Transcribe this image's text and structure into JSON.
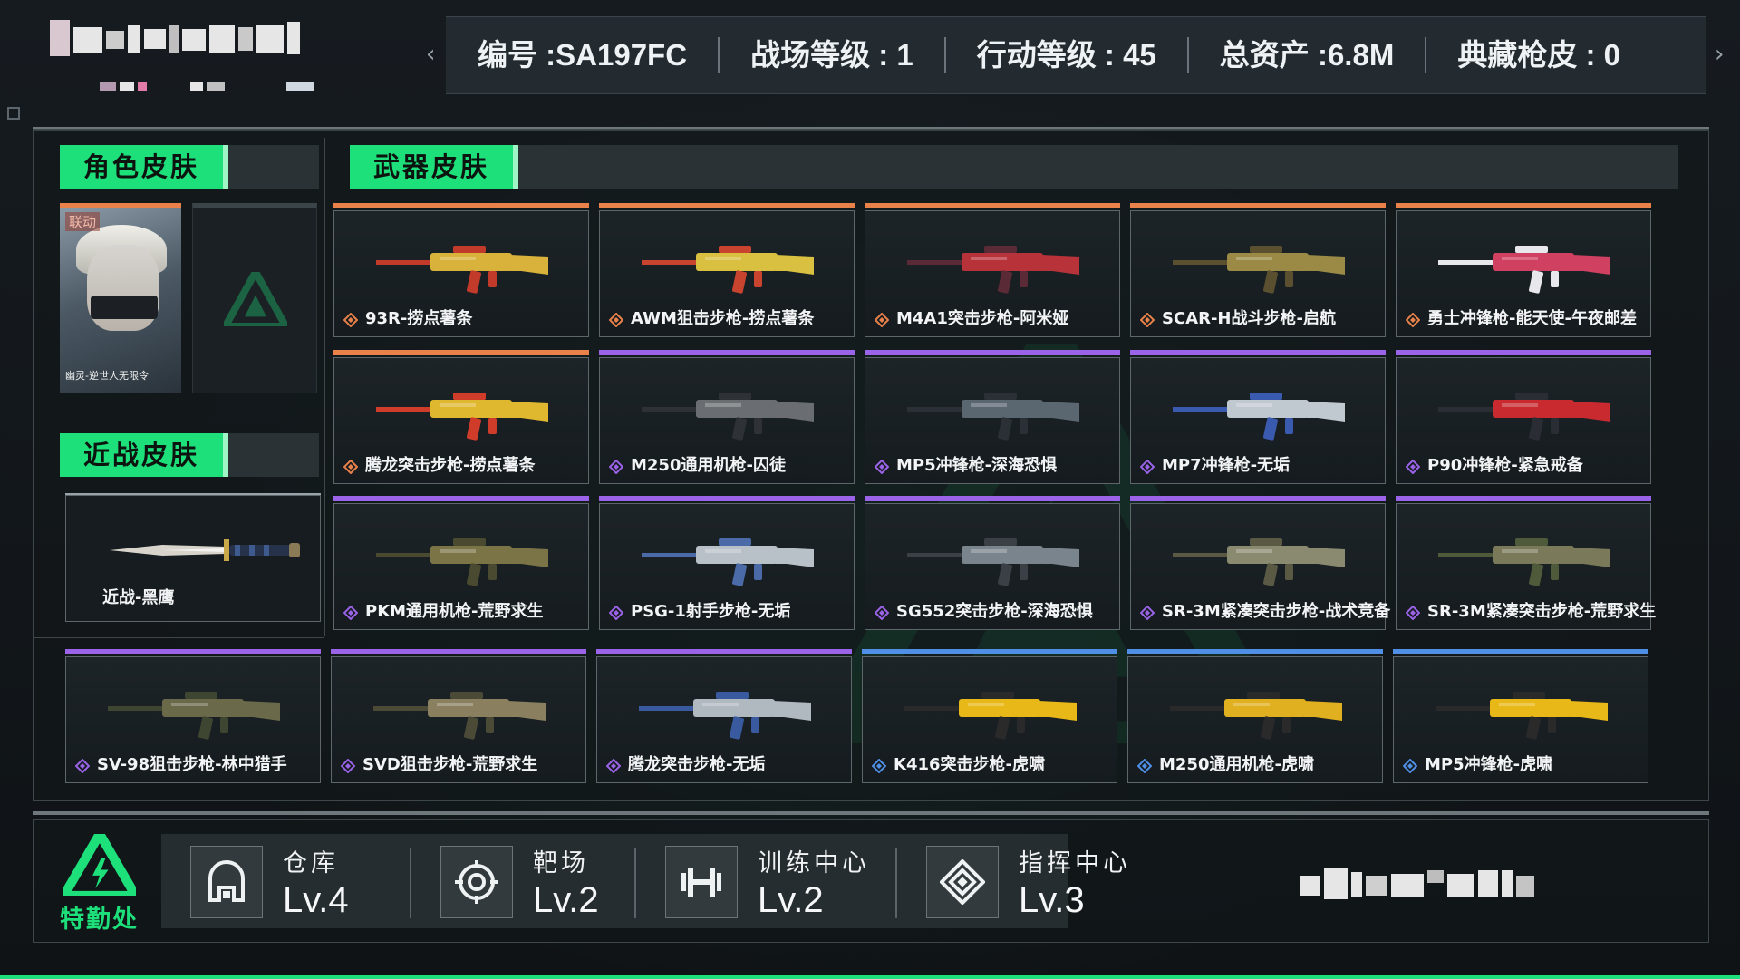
{
  "header": {
    "stats": [
      "编号 :SA197FC",
      "战场等级 : 1",
      "行动等级 :  45",
      "总资产 :6.8M",
      "典藏枪皮 : 0"
    ],
    "nav_left": "‹",
    "nav_right": "›"
  },
  "sections": {
    "character": "角色皮肤",
    "weapon": "武器皮肤",
    "melee": "近战皮肤"
  },
  "character_skin": {
    "badge": "联动",
    "caption": "幽灵-逆世人无限令"
  },
  "melee_skin": {
    "name": "近战-黑鹰"
  },
  "weapons": [
    {
      "name": "93R-捞点薯条",
      "rarity": "orange"
    },
    {
      "name": "AWM狙击步枪-捞点薯条",
      "rarity": "orange"
    },
    {
      "name": "M4A1突击步枪-阿米娅",
      "rarity": "orange"
    },
    {
      "name": "SCAR-H战斗步枪-启航",
      "rarity": "orange"
    },
    {
      "name": "勇士冲锋枪-能天使-午夜邮差",
      "rarity": "orange"
    },
    {
      "name": "腾龙突击步枪-捞点薯条",
      "rarity": "orange"
    },
    {
      "name": "M250通用机枪-囚徒",
      "rarity": "purple"
    },
    {
      "name": "MP5冲锋枪-深海恐惧",
      "rarity": "purple"
    },
    {
      "name": "MP7冲锋枪-无垢",
      "rarity": "purple"
    },
    {
      "name": "P90冲锋枪-紧急戒备",
      "rarity": "purple"
    },
    {
      "name": "PKM通用机枪-荒野求生",
      "rarity": "purple"
    },
    {
      "name": "PSG-1射手步枪-无垢",
      "rarity": "purple"
    },
    {
      "name": "SG552突击步枪-深海恐惧",
      "rarity": "purple"
    },
    {
      "name": "SR-3M紧凑突击步枪-战术竞备",
      "rarity": "purple"
    },
    {
      "name": "SR-3M紧凑突击步枪-荒野求生",
      "rarity": "purple"
    },
    {
      "name": "SV-98狙击步枪-林中猎手",
      "rarity": "purple"
    },
    {
      "name": "SVD狙击步枪-荒野求生",
      "rarity": "purple"
    },
    {
      "name": "腾龙突击步枪-无垢",
      "rarity": "purple"
    },
    {
      "name": "K416突击步枪-虎啸",
      "rarity": "blue"
    },
    {
      "name": "M250通用机枪-虎啸",
      "rarity": "blue"
    },
    {
      "name": "MP5冲锋枪-虎啸",
      "rarity": "blue"
    }
  ],
  "rarity_colors": {
    "orange": "#e9814a",
    "purple": "#9a63e8",
    "blue": "#4f8fe6"
  },
  "bottom": {
    "logo_text": "特勤处",
    "facilities": [
      {
        "name": "仓库",
        "level": "Lv.4",
        "icon": "warehouse-icon"
      },
      {
        "name": "靶场",
        "level": "Lv.2",
        "icon": "target-icon"
      },
      {
        "name": "训练中心",
        "level": "Lv.2",
        "icon": "dumbbell-icon"
      },
      {
        "name": "指挥中心",
        "level": "Lv.3",
        "icon": "command-icon"
      }
    ]
  },
  "accent_color": "#1ee07a"
}
